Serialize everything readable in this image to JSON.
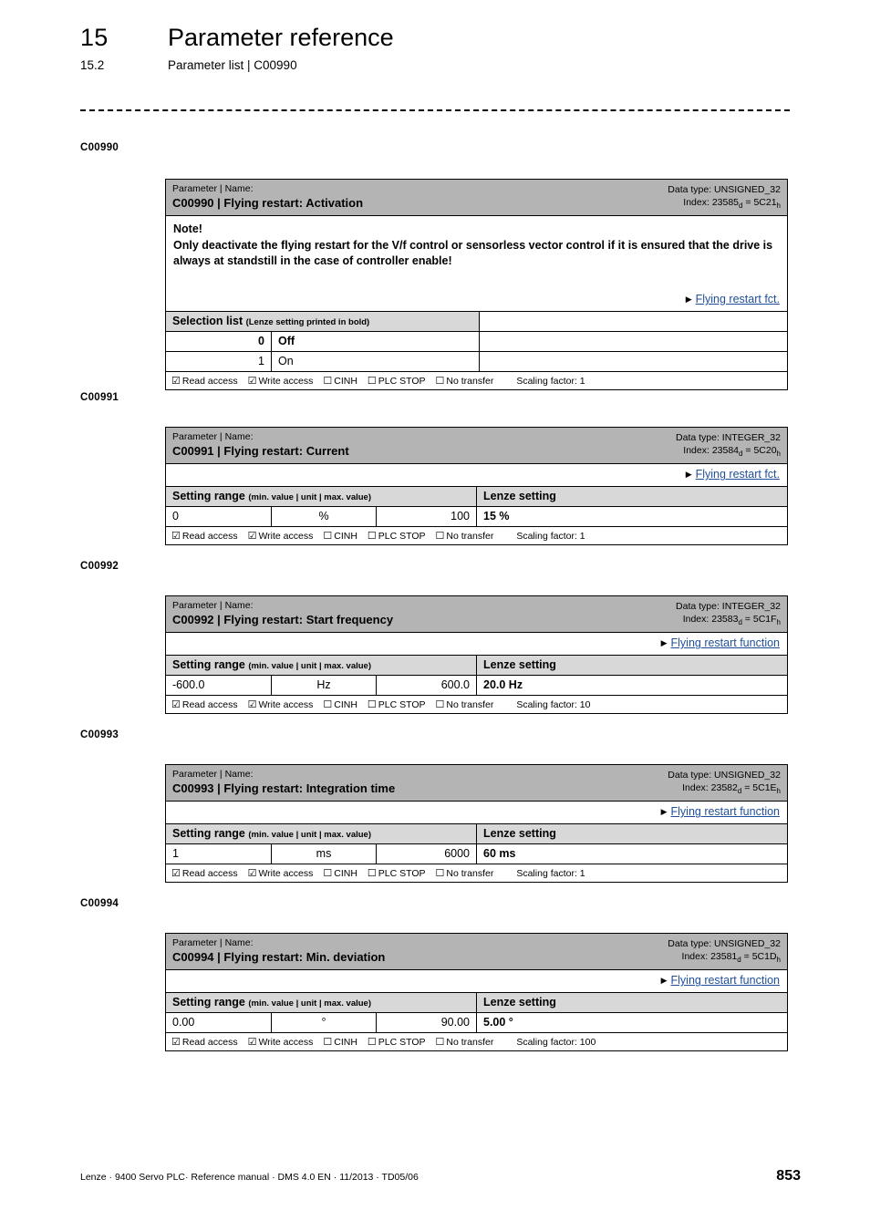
{
  "header": {
    "chapter_number": "15",
    "chapter_title": "Parameter reference",
    "section_number": "15.2",
    "section_title": "Parameter list | C00990"
  },
  "labels": {
    "param_caption": "Parameter | Name:",
    "datatype_prefix": "Data type: ",
    "index_prefix": "Index: ",
    "selection_list": "Selection list ",
    "selection_list_hint": "(Lenze setting printed in bold)",
    "setting_range": "Setting range ",
    "setting_range_hint": "(min. value | unit | max. value)",
    "lenze_setting": "Lenze setting",
    "read_access": "Read access",
    "write_access": "Write access",
    "cinh": "CINH",
    "plc_stop": "PLC STOP",
    "no_transfer": "No transfer",
    "scaling_prefix": "Scaling factor: ",
    "checked_box": "☑",
    "unchecked_box": "☐",
    "link_arrow": "▶"
  },
  "colors": {
    "header_gray": "#b4b4b4",
    "subhead_gray": "#d8d8d8",
    "link_blue": "#1f4f9b",
    "border": "#000000"
  },
  "margin_labels": [
    "C00990",
    "C00991",
    "C00992",
    "C00993",
    "C00994"
  ],
  "parameters": [
    {
      "code": "C00990",
      "name": "C00990 | Flying restart: Activation",
      "data_type": "UNSIGNED_32",
      "index_dec": "23585",
      "index_hex": "5C21",
      "note_title": "Note!",
      "note_body": "Only deactivate the flying restart for the V/f control or sensorless vector control if it is ensured that the drive is always at standstill in the case of controller enable!",
      "link": "Flying restart fct.",
      "selection": [
        {
          "value": "0",
          "label": "Off",
          "bold": true
        },
        {
          "value": "1",
          "label": "On",
          "bold": false
        }
      ],
      "scaling_factor": "1"
    },
    {
      "code": "C00991",
      "name": "C00991 | Flying restart: Current",
      "data_type": "INTEGER_32",
      "index_dec": "23584",
      "index_hex": "5C20",
      "link": "Flying restart fct.",
      "range": {
        "min": "0",
        "unit": "%",
        "max": "100"
      },
      "lenze_value": "15 %",
      "scaling_factor": "1"
    },
    {
      "code": "C00992",
      "name": "C00992 | Flying restart: Start frequency",
      "data_type": "INTEGER_32",
      "index_dec": "23583",
      "index_hex": "5C1F",
      "link": "Flying restart function",
      "range": {
        "min": "-600.0",
        "unit": "Hz",
        "max": "600.0"
      },
      "lenze_value": "20.0 Hz",
      "scaling_factor": "10"
    },
    {
      "code": "C00993",
      "name": "C00993 | Flying restart: Integration time",
      "data_type": "UNSIGNED_32",
      "index_dec": "23582",
      "index_hex": "5C1E",
      "link": "Flying restart function",
      "range": {
        "min": "1",
        "unit": "ms",
        "max": "6000"
      },
      "lenze_value": "60 ms",
      "scaling_factor": "1"
    },
    {
      "code": "C00994",
      "name": "C00994 | Flying restart: Min. deviation",
      "data_type": "UNSIGNED_32",
      "index_dec": "23581",
      "index_hex": "5C1D",
      "link": "Flying restart function",
      "range": {
        "min": "0.00",
        "unit": "°",
        "max": "90.00"
      },
      "lenze_value": "5.00 °",
      "scaling_factor": "100"
    }
  ],
  "footer": {
    "text": "Lenze · 9400 Servo PLC· Reference manual · DMS 4.0 EN · 11/2013 · TD05/06",
    "page_number": "853"
  }
}
